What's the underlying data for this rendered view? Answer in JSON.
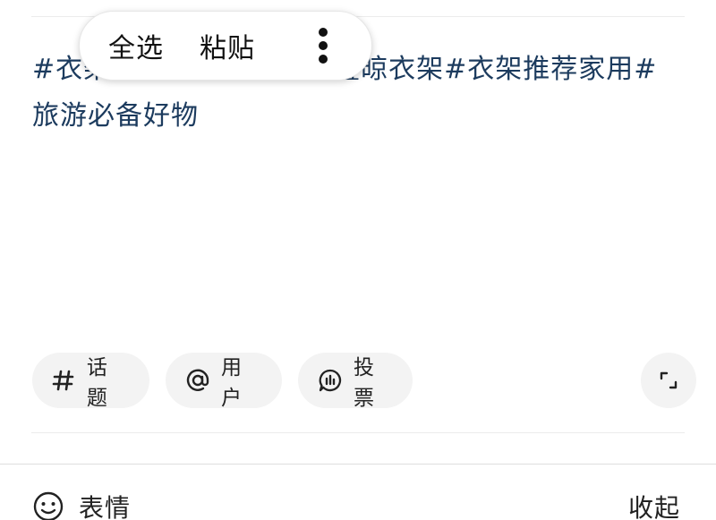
{
  "editor": {
    "text_line1": "#衣架神器家用晾衣架折叠晾衣架#衣架推荐家用#",
    "text_line2": "旅游必备好物"
  },
  "context_menu": {
    "select_all": "全选",
    "paste": "粘贴",
    "more_icon": "more-vertical-icon"
  },
  "toolbar": {
    "topic_label": "话题",
    "topic_icon": "hashtag-icon",
    "user_label": "用户",
    "user_icon": "at-icon",
    "vote_label": "投票",
    "vote_icon": "poll-chat-icon",
    "expand_icon": "expand-icon"
  },
  "bottom_bar": {
    "emoji_label": "表情",
    "emoji_icon": "smiley-icon",
    "collapse_label": "收起"
  },
  "colors": {
    "text": "#1c3b5e",
    "chip_bg": "#f3f3f3"
  }
}
